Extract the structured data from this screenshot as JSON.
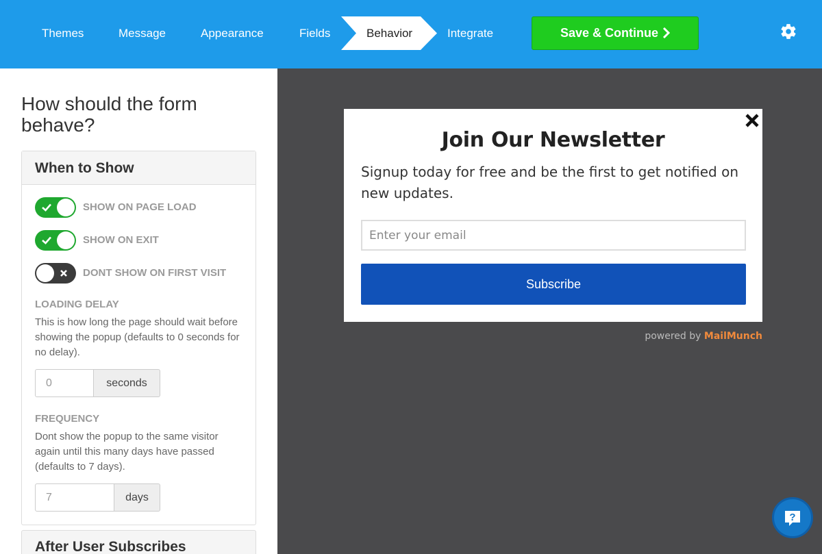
{
  "nav": {
    "tabs": [
      {
        "label": "Themes"
      },
      {
        "label": "Message"
      },
      {
        "label": "Appearance"
      },
      {
        "label": "Fields"
      },
      {
        "label": "Behavior",
        "active": true
      },
      {
        "label": "Integrate"
      }
    ],
    "save_label": "Save & Continue",
    "settings_icon": "gear-icon"
  },
  "panel": {
    "heading": "How should the form behave?",
    "when_to_show": {
      "title": "When to Show",
      "toggles": [
        {
          "label": "SHOW ON PAGE LOAD",
          "on": true
        },
        {
          "label": "SHOW ON EXIT",
          "on": true
        },
        {
          "label": "DONT SHOW ON FIRST VISIT",
          "on": false
        }
      ],
      "loading_delay": {
        "label": "LOADING DELAY",
        "description": "This is how long the page should wait before showing the popup (defaults to 0 seconds for no delay).",
        "value": "0",
        "unit": "seconds"
      },
      "frequency": {
        "label": "FREQUENCY",
        "description": "Dont show the popup to the same visitor again until this many days have passed (defaults to 7 days).",
        "value": "7",
        "unit": "days"
      }
    },
    "after_subscribe": {
      "title": "After User Subscribes"
    }
  },
  "popup": {
    "title": "Join Our Newsletter",
    "text": "Signup today for free and be the first to get notified on new updates.",
    "email_placeholder": "Enter your email",
    "button": "Subscribe",
    "powered_by": "powered by",
    "brand": "MailMunch"
  },
  "colors": {
    "topbar": "#1e9bea",
    "save": "#1fcc1f",
    "toggle_on": "#1fa82f",
    "subscribe": "#1152b8",
    "brand": "#f08a3c"
  }
}
